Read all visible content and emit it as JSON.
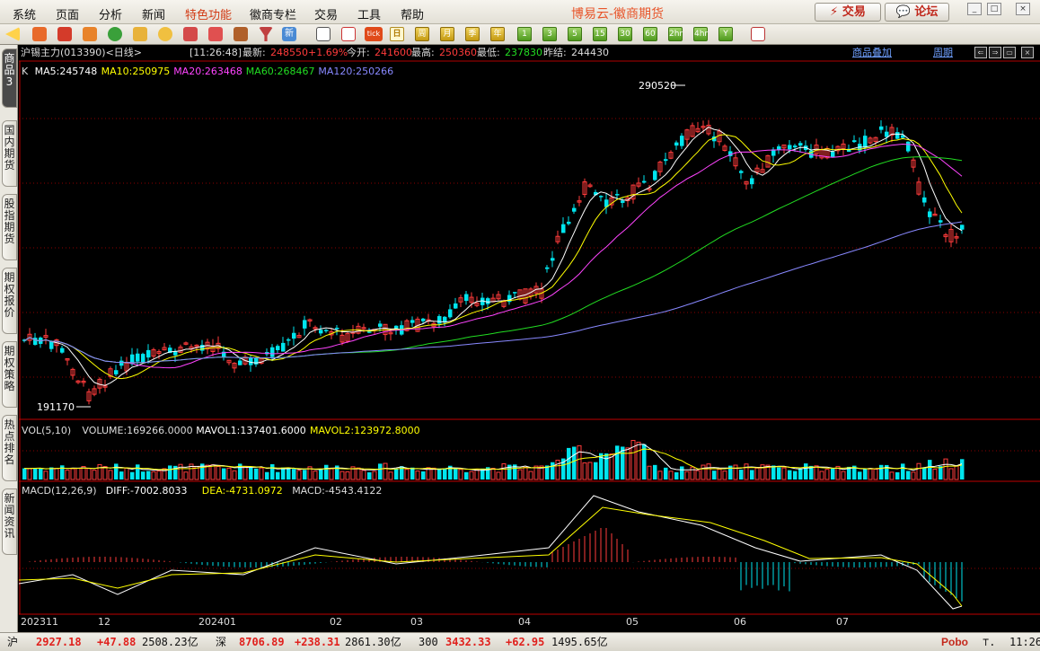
{
  "menu": {
    "items": [
      "系统",
      "页面",
      "分析",
      "新闻",
      "特色功能",
      "徽商专栏",
      "交易",
      "工具",
      "帮助"
    ],
    "highlight_index": 4,
    "app_title": "博易云-徽商期货",
    "trade_button": "⚡ 交易",
    "forum_button": "💬 论坛"
  },
  "toolbar": {
    "periods": [
      "日",
      "周",
      "月",
      "季",
      "年",
      "1",
      "3",
      "5",
      "15",
      "30",
      "60",
      "2hr",
      "4hr",
      "Y"
    ],
    "active_period": "日",
    "tick_label": "tick"
  },
  "left_tabs": [
    "商品3",
    "国内期货",
    "股指期货",
    "期权报价",
    "期权策略",
    "热点排名",
    "新闻资讯"
  ],
  "quote": {
    "name": "沪锡主力(013390)<日线>",
    "time": "[11:26:48]",
    "latest_label": "最新:",
    "latest": "248550",
    "change_pct": "+1.69%",
    "open_label": "今开:",
    "open": "241600",
    "high_label": "最高:",
    "high": "250360",
    "low_label": "最低:",
    "low": "237830",
    "prev_label": "昨结:",
    "prev_close": "244430",
    "overlay_link": "商品叠加",
    "period_link": "周期"
  },
  "ma_legend": {
    "k": "K",
    "ma5": "MA5:245748",
    "ma10": "MA10:250975",
    "ma20": "MA20:263468",
    "ma60": "MA60:268467",
    "ma120": "MA120:250266"
  },
  "vol_legend": {
    "title": "VOL(5,10)",
    "volume": "VOLUME:169266.0000",
    "mavol1": "MAVOL1:137401.6000",
    "mavol2": "MAVOL2:123972.8000"
  },
  "macd_legend": {
    "title": "MACD(12,26,9)",
    "diff": "DIFF:-7002.8033",
    "dea": "DEA:-4731.0972",
    "macd": "MACD:-4543.4122"
  },
  "annotations": {
    "high_mark": "290520",
    "low_mark": "191170"
  },
  "x_axis_labels": [
    "202311",
    "12",
    "202401",
    "02",
    "03",
    "04",
    "05",
    "06",
    "07"
  ],
  "colors": {
    "up": "#ff3b3b",
    "down": "#00e5ee",
    "ma5": "#ffffff",
    "ma10": "#ffff00",
    "ma20": "#ff44ff",
    "ma60": "#22dd22",
    "ma120": "#8888ff",
    "grid": "#8b0000"
  },
  "status": {
    "sh_label": "沪",
    "sh_index": "2927.18",
    "sh_change": "+47.88",
    "sh_amount": "2508.23亿",
    "sz_label": "深",
    "sz_index": "8706.89",
    "sz_change": "+238.31",
    "sz_amount": "2861.30亿",
    "c300_label": "300",
    "c300_index": "3432.33",
    "c300_change": "+62.95",
    "c300_amount": "1495.65亿",
    "brand": "Pobo",
    "clock": "11:26"
  }
}
